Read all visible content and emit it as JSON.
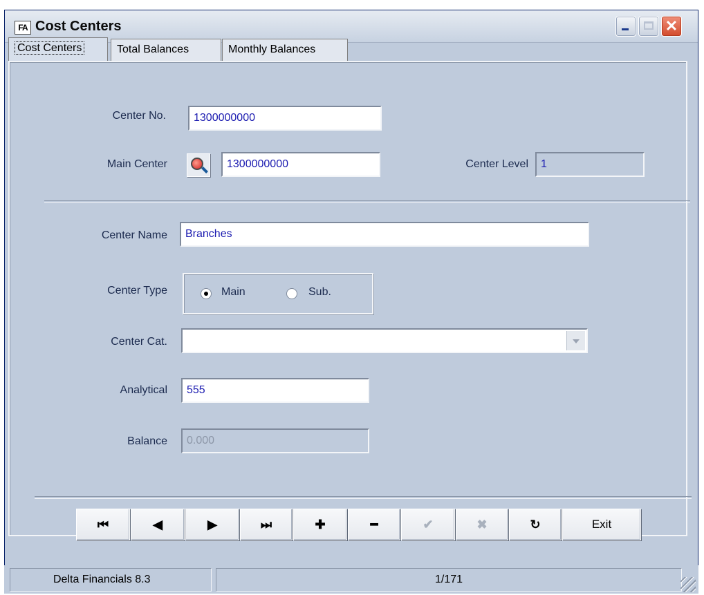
{
  "window": {
    "title": "Cost Centers",
    "icon_text": "FA"
  },
  "tabs": [
    {
      "label": "Cost Centers",
      "active": true
    },
    {
      "label": "Total Balances",
      "active": false
    },
    {
      "label": "Monthly Balances",
      "active": false
    }
  ],
  "form": {
    "center_no": {
      "label": "Center No.",
      "value": "1300000000"
    },
    "main_center": {
      "label": "Main Center",
      "value": "1300000000"
    },
    "center_level": {
      "label": "Center Level",
      "value": "1"
    },
    "center_name": {
      "label": "Center Name",
      "value": "Branches"
    },
    "center_type": {
      "label": "Center Type",
      "options": [
        "Main",
        "Sub."
      ],
      "selected": "Main"
    },
    "center_cat": {
      "label": "Center Cat.",
      "value": ""
    },
    "analytical": {
      "label": "Analytical",
      "value": "555"
    },
    "balance": {
      "label": "Balance",
      "value": "0.000"
    }
  },
  "nav": {
    "first": "⏮",
    "prev": "◀",
    "next": "▶",
    "last": "⏭",
    "add": "✚",
    "delete": "━",
    "save": "✔",
    "cancel": "✖",
    "refresh": "↻",
    "exit": "Exit"
  },
  "status": {
    "app": "Delta Financials 8.3",
    "record": "1/171"
  }
}
